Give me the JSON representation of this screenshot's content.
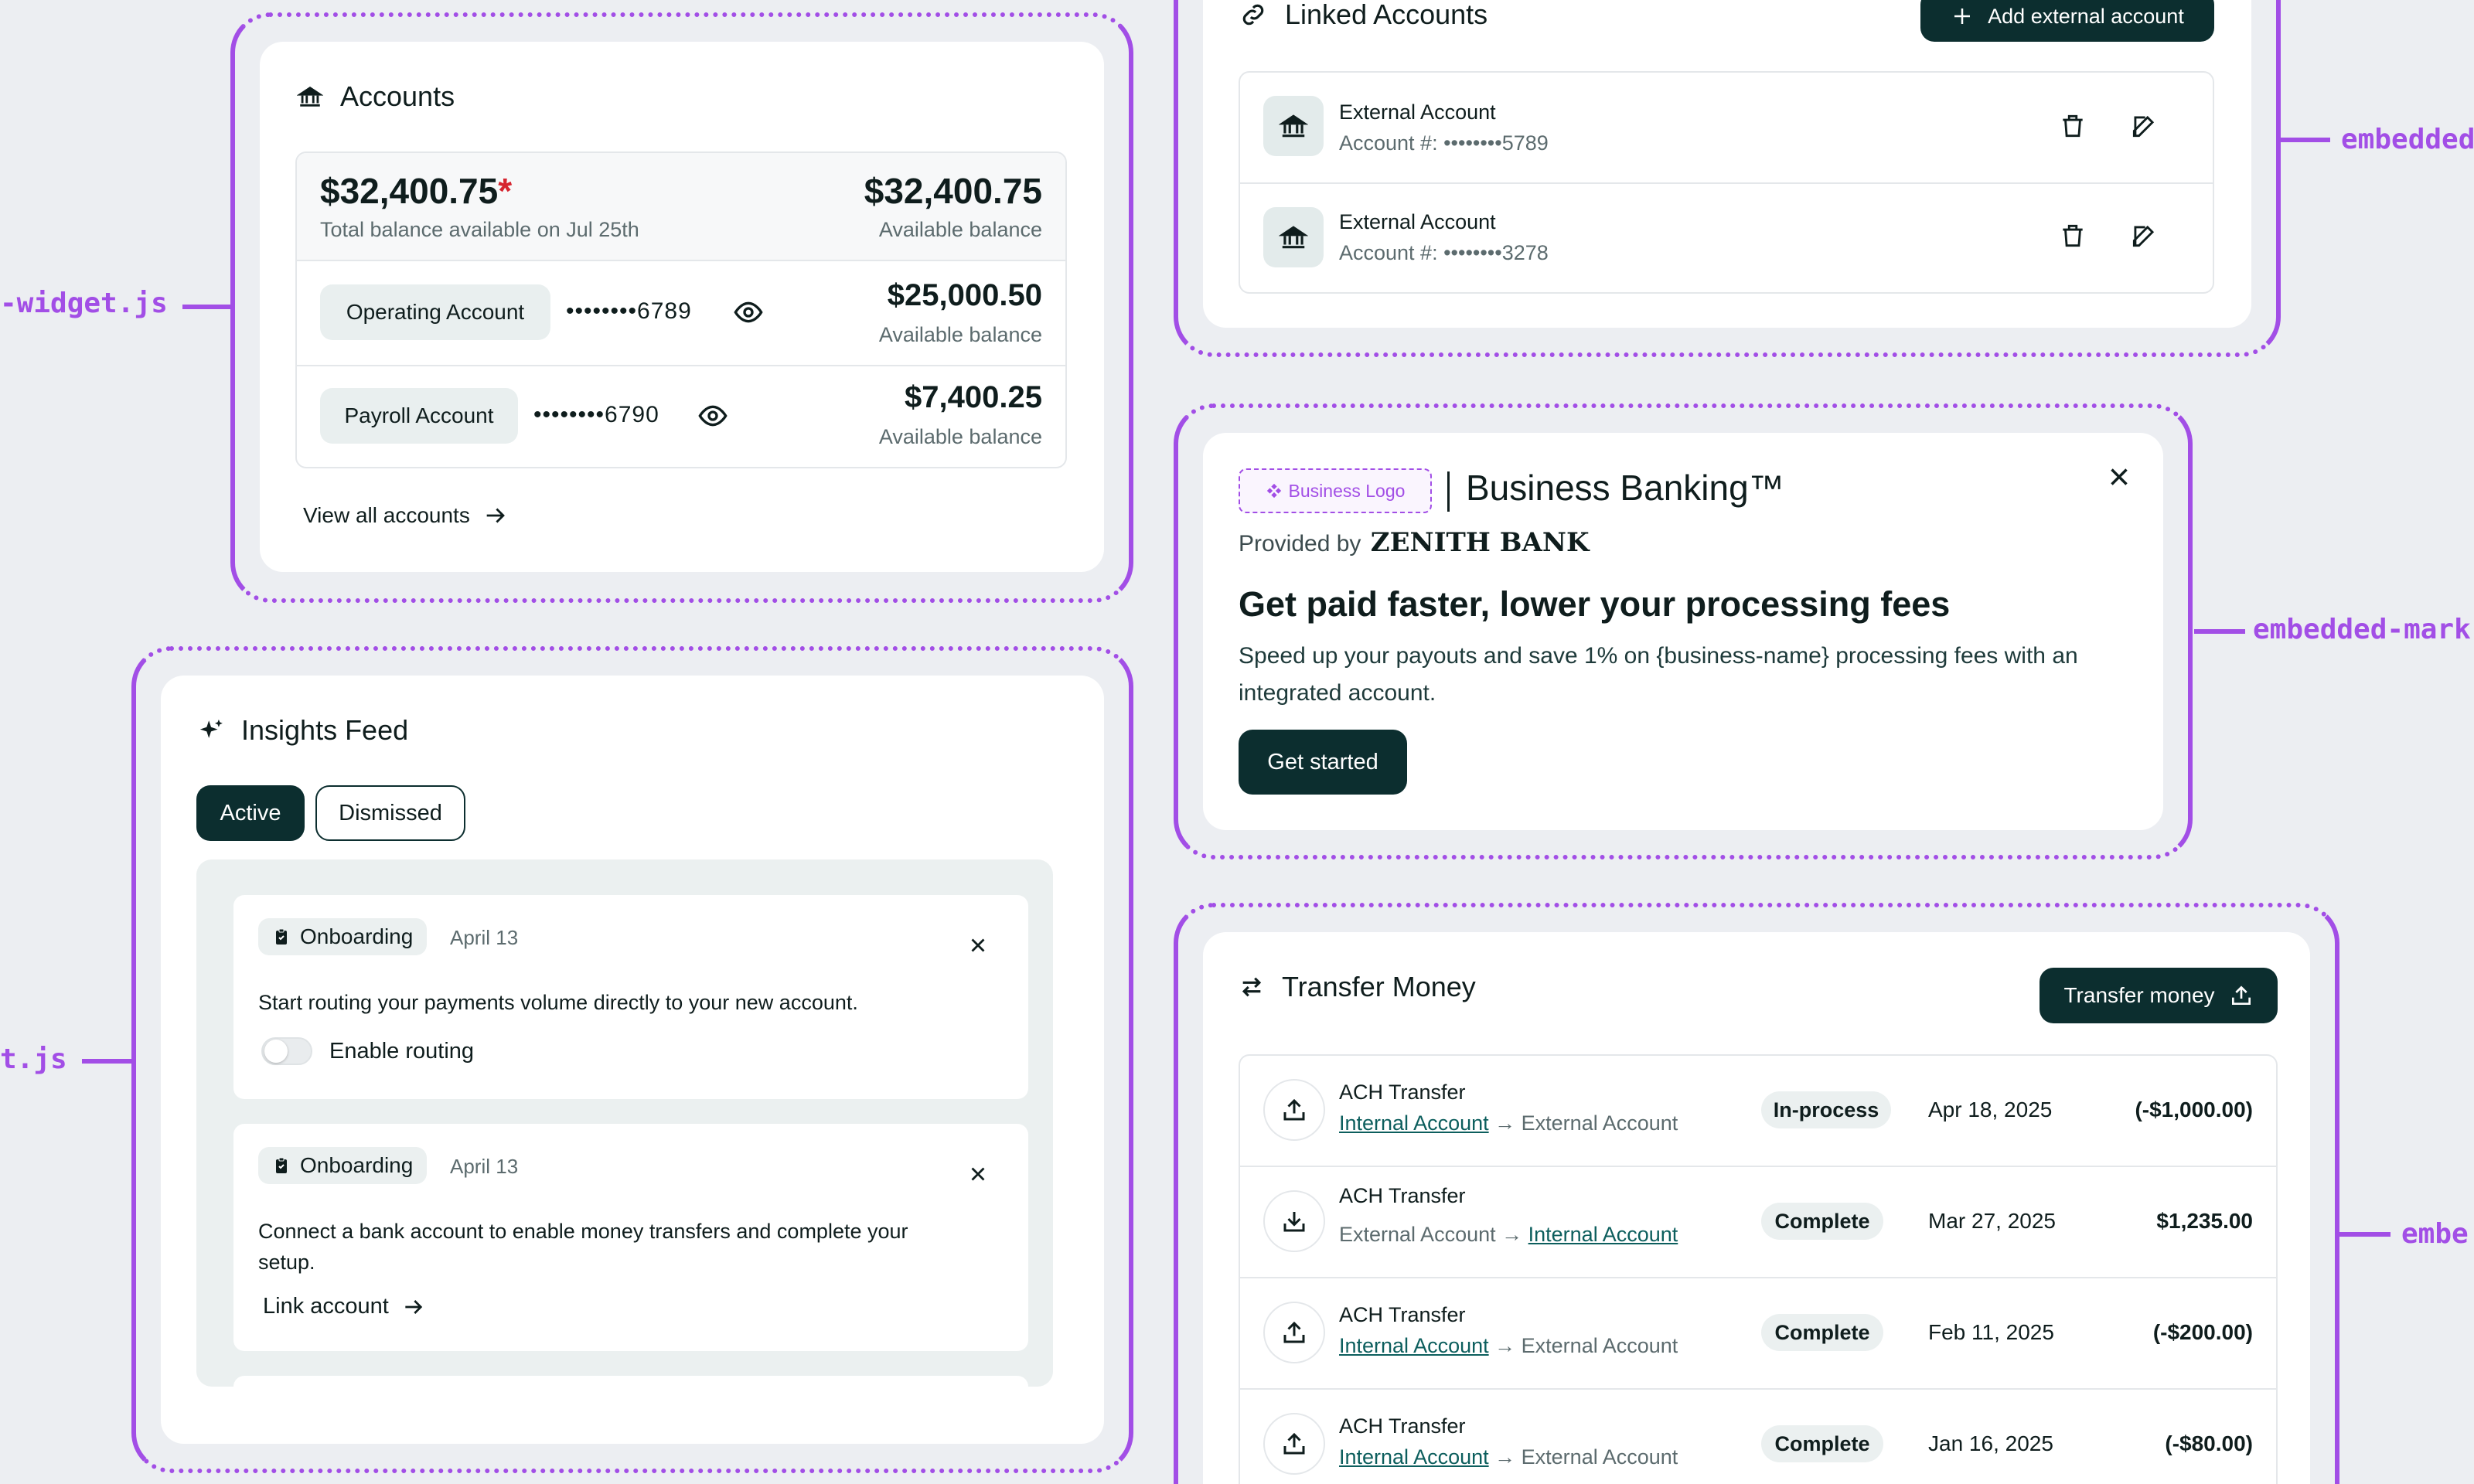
{
  "labels": {
    "left_top": "-widget.js",
    "left_bottom": "t.js",
    "right_top": "embedded",
    "right_middle": "embedded-mark",
    "right_bottom": "embe"
  },
  "accounts": {
    "title": "Accounts",
    "total_amount": "$32,400.75",
    "total_asterisk": "*",
    "total_sub": "Total balance available on Jul 25th",
    "available_total": "$32,400.75",
    "available_label": "Available balance",
    "rows": [
      {
        "name": "Operating Account",
        "mask": "••••••••6789",
        "amount": "$25,000.50",
        "sub": "Available balance"
      },
      {
        "name": "Payroll Account",
        "mask": "••••••••6790",
        "amount": "$7,400.25",
        "sub": "Available balance"
      }
    ],
    "view_all": "View all accounts"
  },
  "insights": {
    "title": "Insights Feed",
    "tabs": [
      "Active",
      "Dismissed"
    ],
    "items": [
      {
        "tag": "Onboarding",
        "date": "April 13",
        "text": "Start routing your payments volume directly to your new account.",
        "action": "Enable routing"
      },
      {
        "tag": "Onboarding",
        "date": "April 13",
        "text_line1": "Connect a bank account to enable money transfers and complete your",
        "text_line2": "setup.",
        "action": "Link account"
      }
    ]
  },
  "linked": {
    "title": "Linked Accounts",
    "add_button": "Add external account",
    "rows": [
      {
        "name": "External Account",
        "label": "Account #:",
        "mask": "••••••••5789"
      },
      {
        "name": "External Account",
        "label": "Account #:",
        "mask": "••••••••3278"
      }
    ]
  },
  "marketing": {
    "logo_badge": "Business Logo",
    "product": "Business Banking™",
    "provided_by": "Provided by",
    "bank": "ZENITH BANK",
    "headline": "Get paid faster, lower your processing fees",
    "body_line1": "Speed up your payouts and save 1% on {business-name} processing fees with an",
    "body_line2": "integrated account.",
    "cta": "Get started"
  },
  "transfer": {
    "title": "Transfer Money",
    "button": "Transfer money",
    "rows": [
      {
        "type": "ACH Transfer",
        "from": "Internal Account",
        "to": "External Account",
        "from_link": true,
        "direction": "out",
        "status": "In-process",
        "date": "Apr 18, 2025",
        "amount": "(-$1,000.00)"
      },
      {
        "type": "ACH Transfer",
        "from": "External Account",
        "to": "Internal Account",
        "from_link": false,
        "direction": "in",
        "status": "Complete",
        "date": "Mar 27, 2025",
        "amount": "$1,235.00"
      },
      {
        "type": "ACH Transfer",
        "from": "Internal Account",
        "to": "External Account",
        "from_link": true,
        "direction": "out",
        "status": "Complete",
        "date": "Feb 11, 2025",
        "amount": "(-$200.00)"
      },
      {
        "type": "ACH Transfer",
        "from": "Internal Account",
        "to": "External Account",
        "from_link": true,
        "direction": "out",
        "status": "Complete",
        "date": "Jan 16, 2025",
        "amount": "(-$80.00)"
      }
    ]
  },
  "colors": {
    "frame": "#a24ee6",
    "primary": "#0c2e2f",
    "link": "#0c5e5d",
    "asterisk": "#d6242f"
  }
}
